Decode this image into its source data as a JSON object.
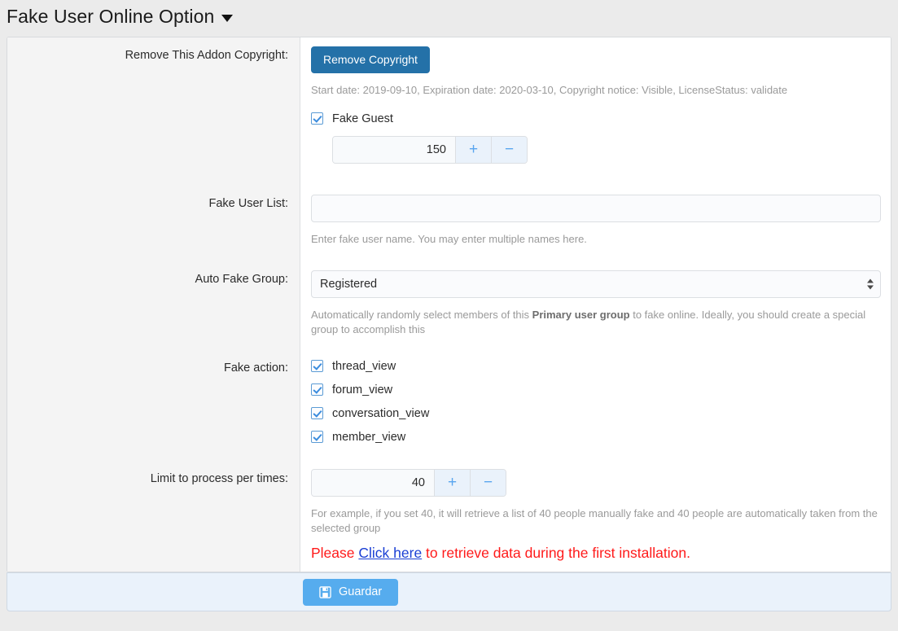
{
  "header": {
    "title": "Fake User Online Option",
    "caret_icon": "chevron-down-icon"
  },
  "form": {
    "copyright": {
      "label": "Remove This Addon Copyright:",
      "button_label": "Remove Copyright",
      "license_info": "Start date: 2019-09-10, Expiration date: 2020-03-10, Copyright notice: Visible, LicenseStatus: validate",
      "fake_guest_label": "Fake Guest",
      "fake_guest_checked": true,
      "fake_guest_value": "150",
      "plus_label": "+",
      "minus_label": "−"
    },
    "fake_user_list": {
      "label": "Fake User List:",
      "value": "",
      "placeholder": "",
      "hint": "Enter fake user name. You may enter multiple names here."
    },
    "auto_fake_group": {
      "label": "Auto Fake Group:",
      "selected": "Registered",
      "hint_before": "Automatically randomly select members of this ",
      "hint_bold": "Primary user group",
      "hint_after": " to fake online. Ideally, you should create a special group to accomplish this"
    },
    "fake_action": {
      "label": "Fake action:",
      "items": [
        {
          "label": "thread_view",
          "checked": true
        },
        {
          "label": "forum_view",
          "checked": true
        },
        {
          "label": "conversation_view",
          "checked": true
        },
        {
          "label": "member_view",
          "checked": true
        }
      ]
    },
    "limit": {
      "label": "Limit to process per times:",
      "value": "40",
      "plus_label": "+",
      "minus_label": "−",
      "hint": "For example, if you set 40, it will retrieve a list of 40 people manually fake and 40 people are automatically taken from the selected group"
    },
    "notice": {
      "before": "Please ",
      "link": "Click here",
      "after": " to retrieve data during the first installation."
    }
  },
  "footer": {
    "save_label": "Guardar",
    "save_icon": "save-floppy-icon"
  },
  "colors": {
    "primary_button": "#2471a8",
    "save_button": "#56acee",
    "notice_text": "#ff1a1a",
    "link": "#1a3fd4",
    "checkbox_accent": "#5b9bd5",
    "footer_bg": "#eaf2fb",
    "label_bg": "#f4f4f4",
    "page_bg": "#ebebeb"
  }
}
